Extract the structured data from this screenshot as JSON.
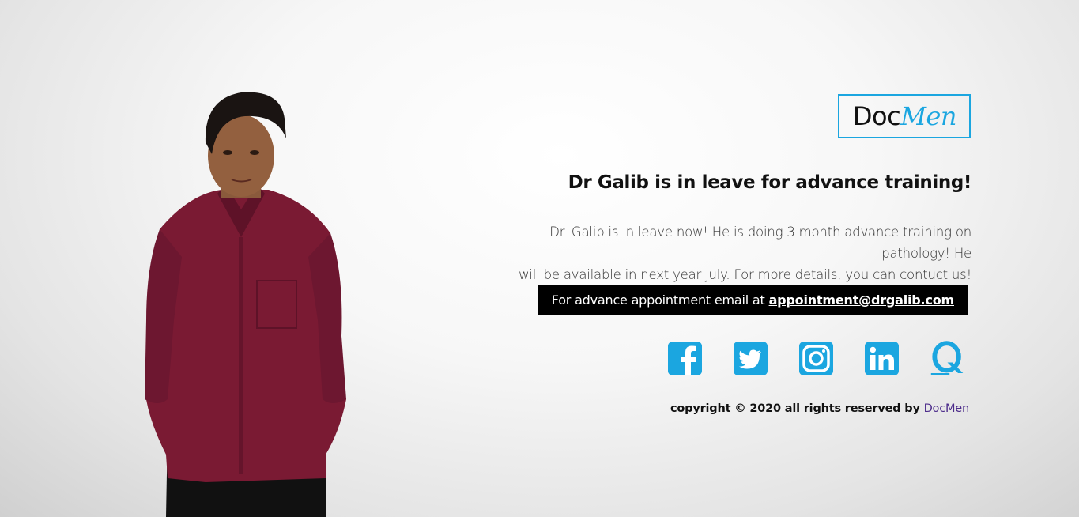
{
  "logo": {
    "part1": "Doc",
    "part2": "Men"
  },
  "headline": "Dr Galib is in leave for advance training!",
  "description_line1": "Dr. Galib is in leave now! He is doing 3 month advance training on pathology! He",
  "description_line2": "will be available in next year july. For more details, you can contuct us!",
  "appointment": {
    "text": "For advance appointment email at",
    "email": "appointment@drgalib.com"
  },
  "socials": [
    "facebook-icon",
    "twitter-icon",
    "instagram-icon",
    "linkedin-icon",
    "quora-icon"
  ],
  "copyright": {
    "text": "copyright © 2020 all rights reserved by",
    "link": "DocMen"
  },
  "colors": {
    "accent": "#1ba6e0",
    "bar": "#000000",
    "link": "#4b2a8a"
  }
}
